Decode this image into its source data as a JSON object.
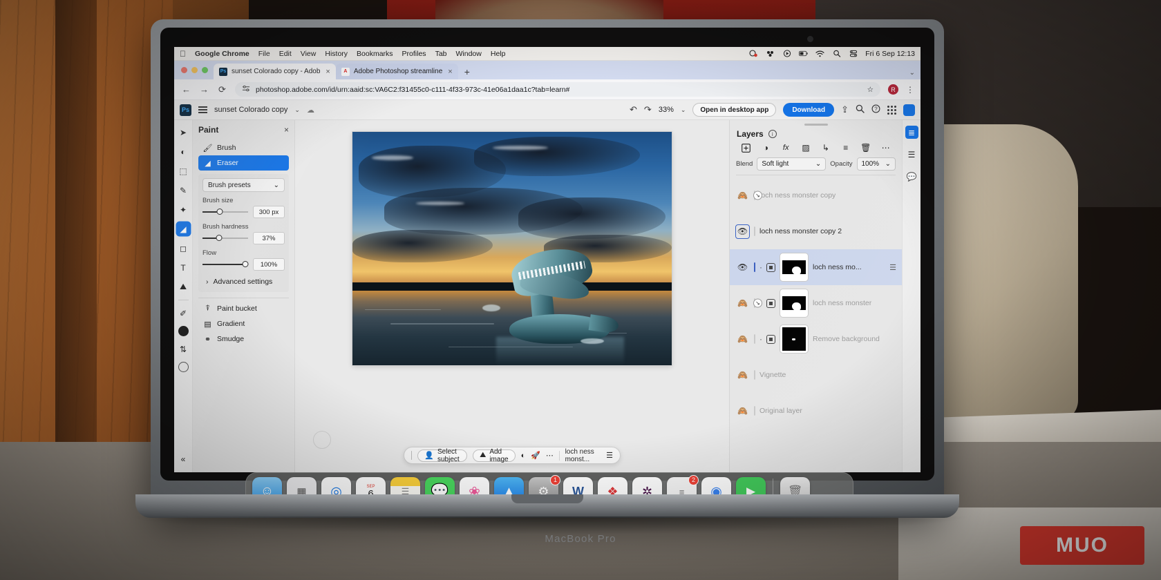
{
  "macos_menubar": {
    "apple_icon": "apple-icon",
    "items": [
      "Google Chrome",
      "File",
      "Edit",
      "View",
      "History",
      "Bookmarks",
      "Profiles",
      "Tab",
      "Window",
      "Help"
    ],
    "status_icons": [
      "screen-recording-icon",
      "control-center-dots-icon",
      "now-playing-icon",
      "battery-icon",
      "wifi-icon",
      "spotlight-search-icon",
      "control-center-icon"
    ],
    "clock": "Fri 6 Sep  12:13"
  },
  "browser": {
    "tabs": [
      {
        "favicon": "photoshop-favicon",
        "title": "sunset Colorado copy - Adob",
        "close": "×",
        "active": true
      },
      {
        "favicon": "adobe-favicon",
        "title": "Adobe Photoshop streamline",
        "close": "×",
        "active": false
      }
    ],
    "new_tab": "+",
    "window_caret": "⌄",
    "nav": {
      "back": "←",
      "forward": "→",
      "reload": "⟳"
    },
    "url": "photoshop.adobe.com/id/urn:aaid:sc:VA6C2:f31455c0-c111-4f33-973c-41e06a1daa1c?tab=learn#",
    "site_info_icon": "site-settings-icon",
    "bookmark_star": "☆",
    "profile_initial": "R",
    "menu": "⋮"
  },
  "ps_toolbar": {
    "logo": "Ps",
    "menu_icon": "hamburger-icon",
    "doc_name": "sunset Colorado copy",
    "doc_caret": "⌄",
    "cloud_icon": "cloud-sync-icon",
    "undo": "↶",
    "redo": "↷",
    "zoom_level": "33%",
    "zoom_caret": "⌄",
    "open_desktop": "Open in desktop app",
    "download": "Download",
    "share_icon": "share-icon",
    "search_icon": "search-icon",
    "help_icon": "help-icon",
    "apps_icon": "app-grid-icon",
    "cc_icon": "creative-cloud-icon"
  },
  "tool_rail": {
    "tools": [
      {
        "name": "move-tool",
        "glyph": "➤",
        "selected": false
      },
      {
        "name": "adjustment-tool",
        "glyph": "◐",
        "selected": false
      },
      {
        "name": "select-subject-tool",
        "glyph": "⬚",
        "selected": false
      },
      {
        "name": "remove-tool",
        "glyph": "✒",
        "selected": false
      },
      {
        "name": "generative-fill-tool",
        "glyph": "✦",
        "selected": false
      },
      {
        "name": "eraser-tool",
        "glyph": "◢",
        "selected": true
      },
      {
        "name": "shape-tool",
        "glyph": "□",
        "selected": false
      },
      {
        "name": "type-tool",
        "glyph": "T",
        "selected": false
      },
      {
        "name": "add-image-tool",
        "glyph": "⛰",
        "selected": false
      },
      {
        "name": "eyedropper-tool",
        "glyph": "✐",
        "selected": false
      }
    ],
    "foreground_swatch": "#1a1a1a",
    "swap_icon": "⇅",
    "background_swatch": "#ffffff",
    "collapse_icon": "«"
  },
  "paint_panel": {
    "title": "Paint",
    "close": "×",
    "brush": {
      "label": "Brush",
      "icon": "brush-icon"
    },
    "eraser": {
      "label": "Eraser",
      "icon": "eraser-icon",
      "selected": true
    },
    "presets": {
      "label": "Brush presets",
      "caret": "⌄"
    },
    "controls": [
      {
        "label": "Brush size",
        "value": "300 px",
        "fill_pct": 38
      },
      {
        "label": "Brush hardness",
        "value": "37%",
        "fill_pct": 37
      },
      {
        "label": "Flow",
        "value": "100%",
        "fill_pct": 94
      }
    ],
    "advanced": {
      "label": "Advanced settings",
      "caret": "›"
    },
    "extras": [
      {
        "label": "Paint bucket",
        "icon": "paint-bucket-icon"
      },
      {
        "label": "Gradient",
        "icon": "gradient-icon"
      },
      {
        "label": "Smudge",
        "icon": "smudge-icon"
      }
    ]
  },
  "canvas": {
    "context_bar": {
      "select_subject": "Select subject",
      "select_subject_icon": "person-icon",
      "add_image": "Add image",
      "add_image_icon": "add-image-icon",
      "adjust_icon": "adjustment-icon",
      "generative_icon": "generative-fill-icon",
      "more_icon": "⋯",
      "layer_name": "loch ness monst...",
      "properties_icon": "sliders-icon"
    }
  },
  "layers_panel": {
    "title": "Layers",
    "info_icon": "i",
    "actions": [
      {
        "name": "add-layer-button",
        "glyph": "+"
      },
      {
        "name": "adjustment-layer-button",
        "glyph": "◑"
      },
      {
        "name": "layer-effects-button",
        "glyph": "fx"
      },
      {
        "name": "layer-mask-button",
        "glyph": "◨"
      },
      {
        "name": "clipping-mask-button",
        "glyph": "↳"
      },
      {
        "name": "group-layers-button",
        "glyph": "≣"
      },
      {
        "name": "delete-layer-button",
        "glyph": "Ὕ1"
      },
      {
        "name": "more-options-button",
        "glyph": "⋯"
      }
    ],
    "blend_label": "Blend",
    "blend_value": "Soft light",
    "blend_caret": "⌄",
    "opacity_label": "Opacity",
    "opacity_value": "100%",
    "opacity_caret": "⌄",
    "layers": [
      {
        "name": "loch ness monster copy",
        "visible": false,
        "selected": false,
        "has_mask": false,
        "thumb": "transparent-photo",
        "eye_boxed": false,
        "clipped": true
      },
      {
        "name": "loch ness monster copy 2",
        "visible": true,
        "selected": false,
        "has_mask": false,
        "thumb": "transparent-beast",
        "eye_boxed": true,
        "clipped": false
      },
      {
        "name": "loch ness mo...",
        "visible": true,
        "selected": true,
        "has_mask": true,
        "thumb": "transparent-photo",
        "eye_boxed": false,
        "clipped": false
      },
      {
        "name": "loch ness monster",
        "visible": false,
        "selected": false,
        "has_mask": true,
        "thumb": "transparent-photo",
        "eye_boxed": false,
        "clipped": true
      },
      {
        "name": "Remove background",
        "visible": false,
        "selected": false,
        "has_mask": true,
        "thumb": "photo",
        "eye_boxed": false,
        "clipped": true
      },
      {
        "name": "Vignette",
        "visible": false,
        "selected": false,
        "has_mask": false,
        "thumb": "photo",
        "eye_boxed": false,
        "clipped": false
      },
      {
        "name": "Original layer",
        "visible": false,
        "selected": false,
        "has_mask": false,
        "thumb": "photo",
        "eye_boxed": false,
        "clipped": false
      }
    ]
  },
  "right_rail": {
    "items": [
      {
        "name": "layers-panel-toggle",
        "glyph": "≣",
        "selected": true
      },
      {
        "name": "properties-panel-toggle",
        "glyph": "≡",
        "selected": false
      },
      {
        "name": "comments-panel-toggle",
        "glyph": "▭",
        "selected": false
      }
    ]
  },
  "dock": {
    "apps": [
      {
        "name": "finder",
        "glyph": "☺",
        "bg": "#3aa0f0",
        "badge": null,
        "running": true
      },
      {
        "name": "launchpad",
        "glyph": "☷",
        "bg": "#f2f2f4",
        "badge": null,
        "running": false
      },
      {
        "name": "safari",
        "glyph": "◎",
        "bg": "#ffffff",
        "badge": null,
        "running": false
      },
      {
        "name": "calendar",
        "glyph": "6",
        "bg": "#ffffff",
        "badge": null,
        "running": false
      },
      {
        "name": "notes",
        "glyph": "☰",
        "bg": "#fdd94e",
        "badge": null,
        "running": false
      },
      {
        "name": "messages",
        "glyph": "◯",
        "bg": "#4bd964",
        "badge": null,
        "running": false
      },
      {
        "name": "photos",
        "glyph": "❁",
        "bg": "#ffffff",
        "badge": null,
        "running": false
      },
      {
        "name": "app-store",
        "glyph": "A",
        "bg": "#1e8bf0",
        "badge": null,
        "running": false
      },
      {
        "name": "system-settings",
        "glyph": "⚙",
        "bg": "#8d8d8d",
        "badge": "1",
        "running": false
      },
      {
        "name": "microsoft-word",
        "glyph": "W",
        "bg": "#2b579a",
        "badge": null,
        "running": false
      },
      {
        "name": "dot-app",
        "glyph": "⁙",
        "bg": "#ffffff",
        "badge": null,
        "running": false
      },
      {
        "name": "slack",
        "glyph": "✱",
        "bg": "#ffffff",
        "badge": null,
        "running": false
      },
      {
        "name": "reminders",
        "glyph": "≡",
        "bg": "#f7f7f7",
        "badge": "2",
        "running": true
      },
      {
        "name": "google-chrome",
        "glyph": "◉",
        "bg": "#ffffff",
        "badge": null,
        "running": true
      },
      {
        "name": "facetime",
        "glyph": "▶",
        "bg": "#41cc5a",
        "badge": null,
        "running": true
      }
    ],
    "trash": {
      "name": "trash",
      "glyph": "Ὕ1"
    }
  },
  "laptop": {
    "model_label": "MacBook Pro"
  },
  "watermark": {
    "text": "MUO",
    "color": "#e03a2f"
  }
}
